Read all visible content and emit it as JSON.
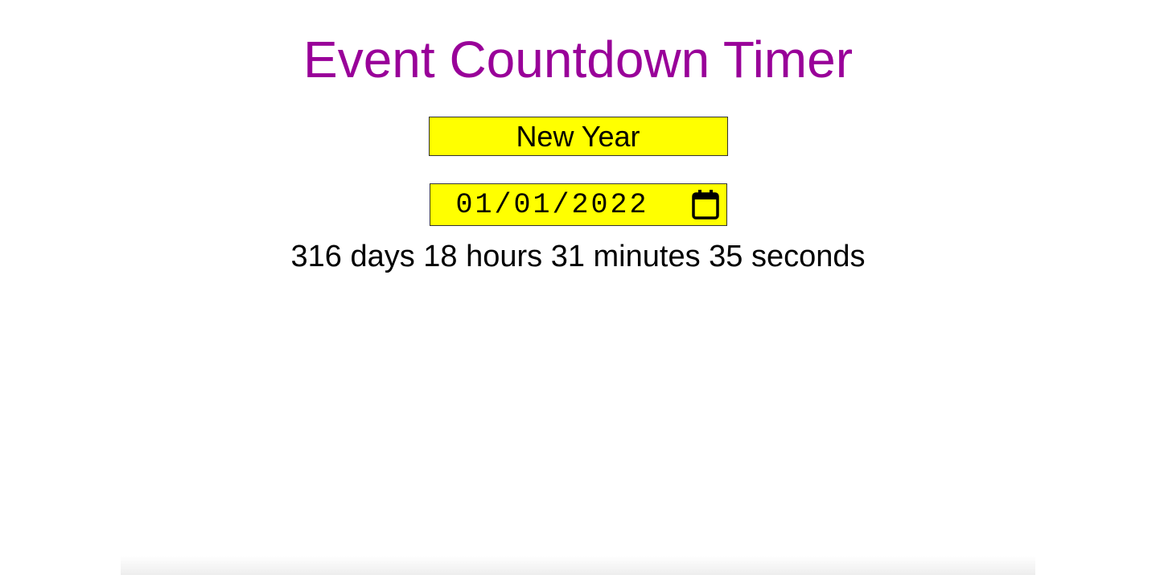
{
  "title": "Event Countdown Timer",
  "event_name": {
    "value": "New Year"
  },
  "event_date": {
    "value": "01/01/2022",
    "icon": "calendar-icon"
  },
  "countdown_text": "316 days 18 hours 31 minutes 35 seconds",
  "colors": {
    "title": "#990099",
    "input_background": "#ffff00",
    "text": "#000000"
  }
}
